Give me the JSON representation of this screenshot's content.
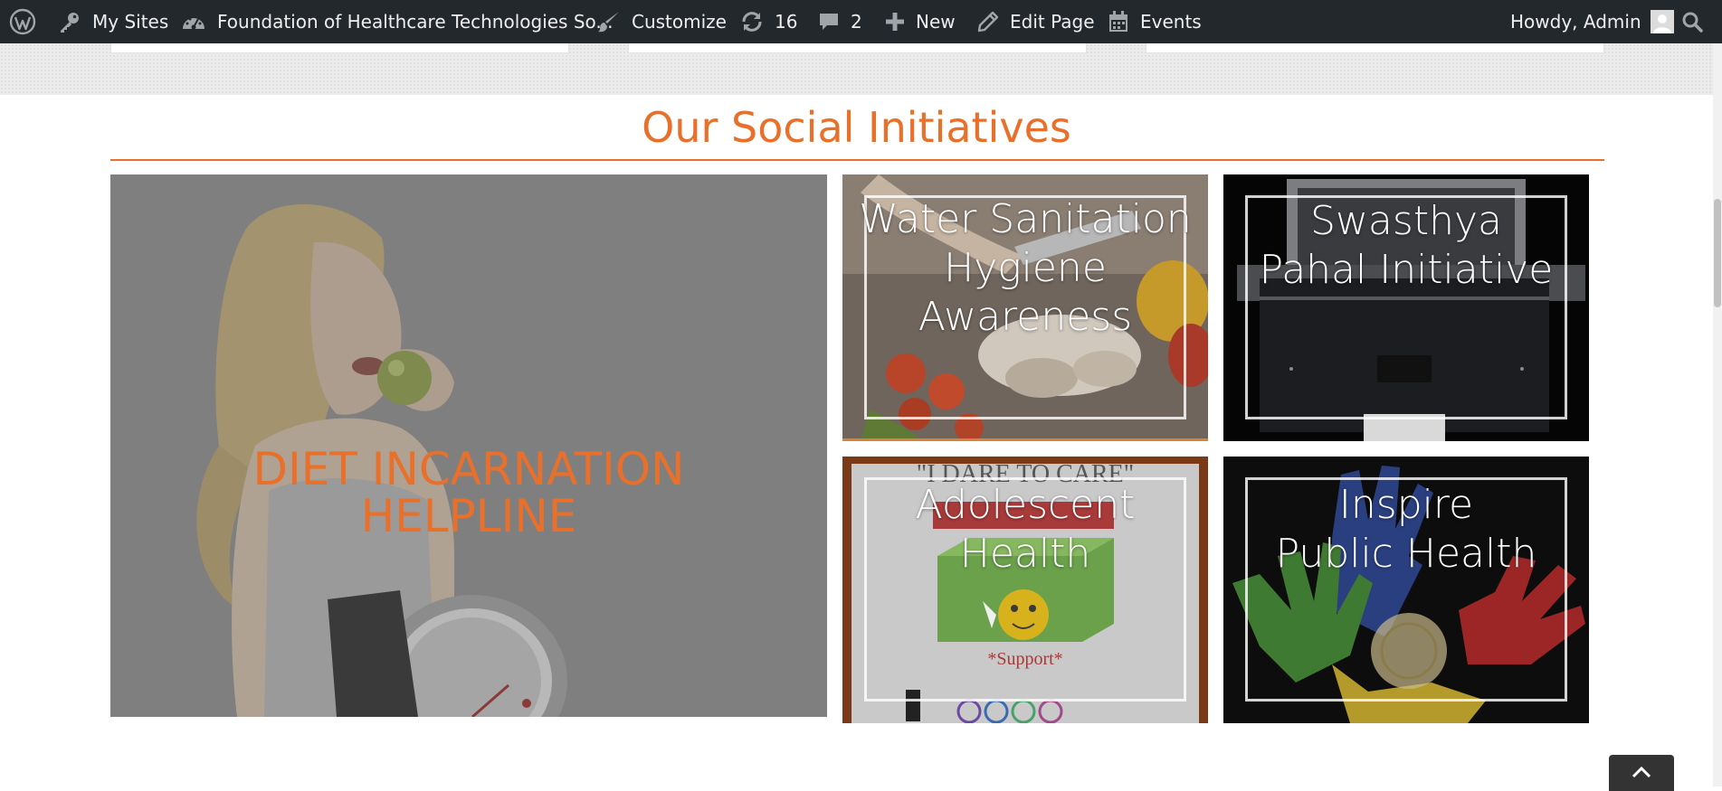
{
  "admin_bar": {
    "my_sites": "My Sites",
    "site_name": "Foundation of Healthcare Technologies So...",
    "customize": "Customize",
    "updates_count": "16",
    "comments_count": "2",
    "new": "New",
    "edit_page": "Edit Page",
    "events": "Events",
    "greeting": "Howdy, Admin",
    "icons": [
      "wordpress-icon",
      "key-icon",
      "dashboard-icon",
      "brush-icon",
      "updates-icon",
      "comment-icon",
      "plus-icon",
      "pencil-icon",
      "calendar-icon",
      "avatar",
      "search-icon"
    ]
  },
  "section": {
    "title": "Our Social Initiatives"
  },
  "tiles": {
    "diet": {
      "line1": "DIET INCARNATION",
      "line2": "HELPLINE"
    },
    "water": {
      "line1": "Water Sanitation",
      "line2": "Hygiene",
      "line3": "Awareness"
    },
    "swasthya": {
      "line1": "Swasthya",
      "line2": "Pahal Initiative"
    },
    "adolescent": {
      "line1": "Adolescent",
      "line2": "Health",
      "poster_text": "\"I DARE TO CARE\"",
      "support_text": "*Support*"
    },
    "inspire": {
      "line1": "Inspire",
      "line2": "Public Health"
    }
  },
  "colors": {
    "accent": "#e8702a",
    "admin_bar_bg": "#23282d",
    "admin_bar_text": "#eeeeee"
  }
}
